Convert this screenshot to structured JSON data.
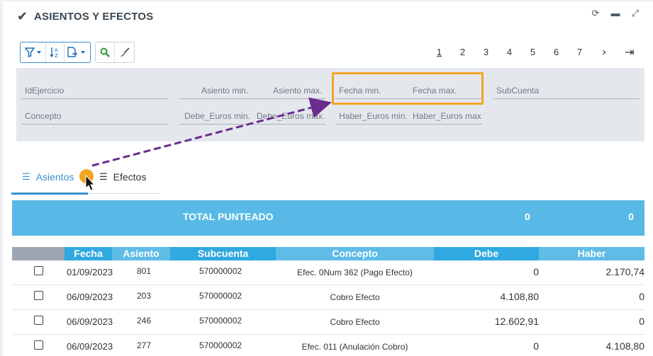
{
  "window": {
    "title": "ASIENTOS Y EFECTOS",
    "controls": [
      "refresh-icon",
      "minimize-icon",
      "expand-icon"
    ]
  },
  "toolbar": {
    "icons": [
      "filter-icon",
      "chevron-down-icon",
      "sort-az-icon",
      "export-icon",
      "chevron-down-icon",
      "search-icon",
      "brush-icon"
    ]
  },
  "pager": {
    "pages": [
      "1",
      "2",
      "3",
      "4",
      "5",
      "6",
      "7"
    ],
    "active": "1",
    "next": "›",
    "last": "⇥"
  },
  "filters": {
    "id_ejercicio": "IdEjercicio",
    "asiento_min": "Asiento min.",
    "asiento_max": "Asiento max.",
    "fecha_min": "Fecha min.",
    "fecha_max": "Fecha max.",
    "subcuenta": "SubCuenta",
    "concepto": "Concepto",
    "debe_min": "Debe_Euros min.",
    "debe_max": "Debe_Euros max.",
    "haber_min": "Haber_Euros min.",
    "haber_max": "Haber_Euros max"
  },
  "tabs": [
    {
      "label": "Asientos",
      "active": true
    },
    {
      "label": "Efectos",
      "active": false
    }
  ],
  "total": {
    "label": "TOTAL PUNTEADO",
    "debe": "0",
    "haber": "0"
  },
  "grid": {
    "columns": [
      "Fecha",
      "Asiento",
      "Subcuenta",
      "Concepto",
      "Debe",
      "Haber"
    ],
    "rows": [
      {
        "fecha": "01/09/2023",
        "asiento": "801",
        "subcuenta": "570000002",
        "concepto": "Efec. 0Num 362 (Pago Efecto)",
        "debe": "0",
        "haber": "2.170,74"
      },
      {
        "fecha": "06/09/2023",
        "asiento": "203",
        "subcuenta": "570000002",
        "concepto": "Cobro Efecto",
        "debe": "4.108,80",
        "haber": "0"
      },
      {
        "fecha": "06/09/2023",
        "asiento": "246",
        "subcuenta": "570000002",
        "concepto": "Cobro Efecto",
        "debe": "12.602,91",
        "haber": "0"
      },
      {
        "fecha": "06/09/2023",
        "asiento": "277",
        "subcuenta": "570000002",
        "concepto": "Efec. 011 (Anulación Cobro)",
        "debe": "0",
        "haber": "4.108,80"
      }
    ]
  },
  "colors": {
    "accent": "#3a90cf",
    "highlight": "#f0a529",
    "arrow": "#6a2c8e",
    "total_bar": "#58b9e6"
  }
}
